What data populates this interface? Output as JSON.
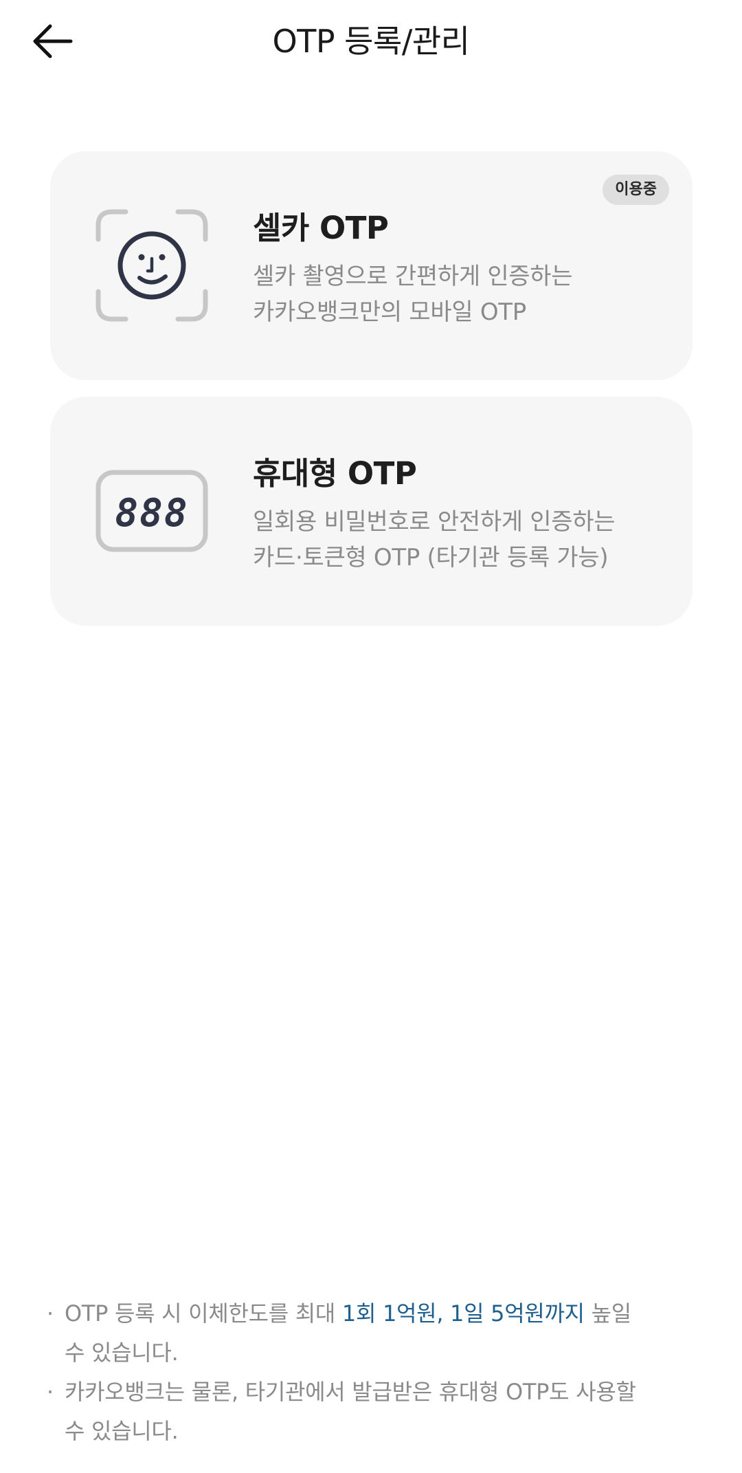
{
  "header": {
    "title": "OTP 등록/관리"
  },
  "cards": {
    "selfie": {
      "title": "셀카 OTP",
      "desc_line1": "셀카 촬영으로 간편하게 인증하는",
      "desc_line2": "카카오뱅크만의 모바일 OTP",
      "badge": "이용중",
      "icon": "face-scan-icon"
    },
    "portable": {
      "title": "휴대형 OTP",
      "desc_line1": "일회용 비밀번호로 안전하게 인증하는",
      "desc_line2": "카드·토큰형 OTP (타기관 등록 가능)",
      "icon_text": "888",
      "icon": "otp-token-icon"
    }
  },
  "notes": {
    "note1_prefix": "OTP 등록 시 이체한도를 최대 ",
    "note1_highlight": "1회 1억원, 1일 5억원까지",
    "note1_suffix": " 높일",
    "note1_line2": "수 있습니다.",
    "note2_line1": "카카오뱅크는 물론, 타기관에서 발급받은 휴대형 OTP도 사용할",
    "note2_line2": "수 있습니다.",
    "bullet": "·"
  },
  "colors": {
    "card_bg": "#f6f6f6",
    "highlight": "#1f5f8f",
    "muted_text": "#8a8a8a"
  }
}
